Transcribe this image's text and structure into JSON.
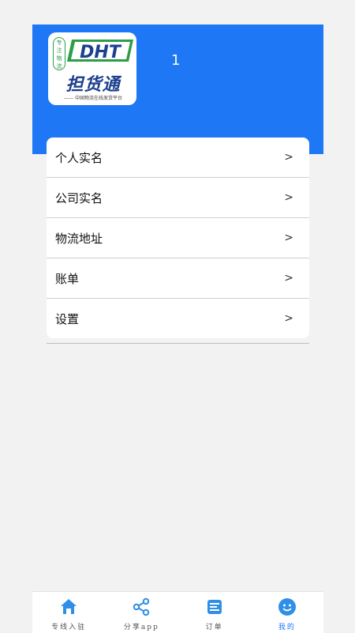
{
  "header": {
    "logo": {
      "stamp_text": "专注物流",
      "mark": "DHT",
      "brand": "担货通",
      "slogan": "—— 中国物流在线发货平台"
    },
    "username": "1"
  },
  "menu": {
    "items": [
      {
        "label": "个人实名",
        "arrow": ">"
      },
      {
        "label": "公司实名",
        "arrow": ">"
      },
      {
        "label": "物流地址",
        "arrow": ">"
      },
      {
        "label": "账单",
        "arrow": ">"
      },
      {
        "label": "设置",
        "arrow": ">"
      }
    ]
  },
  "tabbar": {
    "tabs": [
      {
        "label": "专线入驻",
        "icon": "home-icon"
      },
      {
        "label": "分享app",
        "icon": "share-icon"
      },
      {
        "label": "订单",
        "icon": "order-icon"
      },
      {
        "label": "我的",
        "icon": "profile-icon",
        "active": true
      }
    ]
  },
  "colors": {
    "primary": "#1e78f5",
    "logo_green": "#2c9e48",
    "logo_navy": "#1d3f8f"
  }
}
